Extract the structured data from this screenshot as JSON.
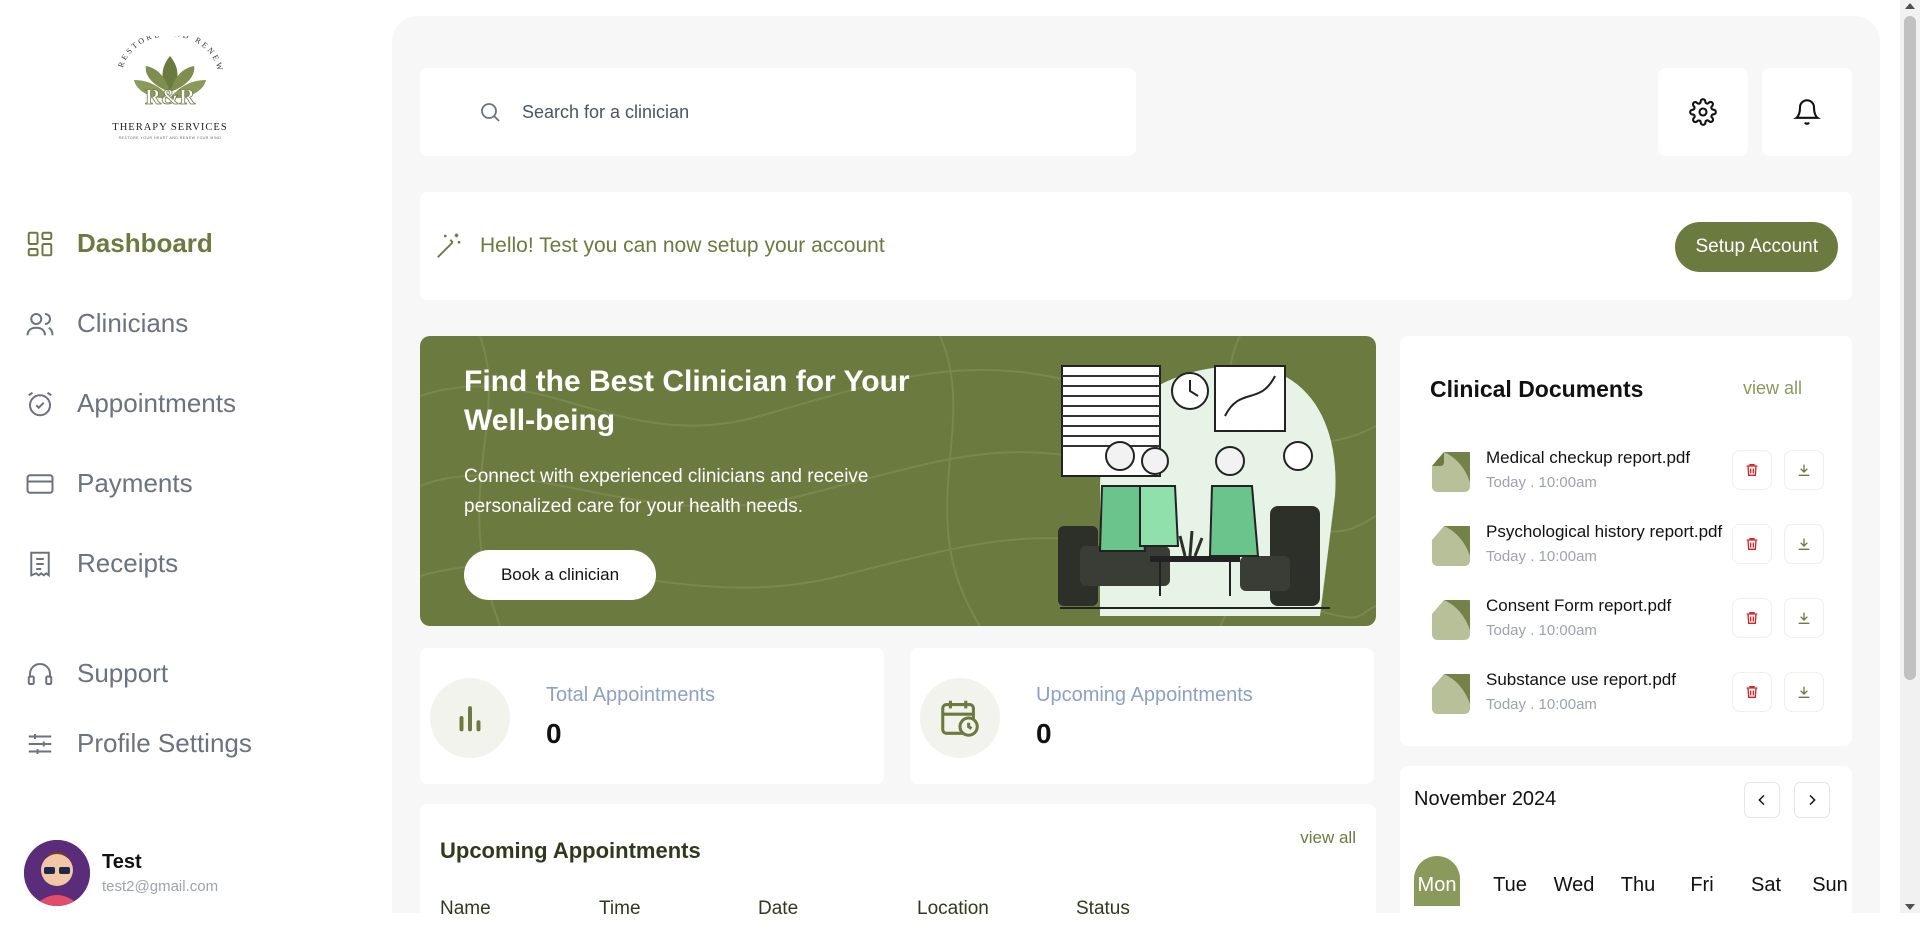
{
  "brand": {
    "arc_text": "RESTORE AND RENEW",
    "initials": "R&R",
    "name": "THERAPY SERVICES",
    "tagline": "RESTORE YOUR HEART AND RENEW YOUR MIND",
    "color": "#6b7b3f"
  },
  "sidebar": {
    "items": [
      {
        "label": "Dashboard",
        "icon": "dashboard-icon",
        "active": true
      },
      {
        "label": "Clinicians",
        "icon": "users-icon"
      },
      {
        "label": "Appointments",
        "icon": "alarm-clock-icon"
      },
      {
        "label": "Payments",
        "icon": "credit-card-icon"
      },
      {
        "label": "Receipts",
        "icon": "receipt-icon"
      },
      {
        "label": "Support",
        "icon": "headset-icon"
      },
      {
        "label": "Profile Settings",
        "icon": "sliders-icon"
      }
    ]
  },
  "user": {
    "name": "Test",
    "email": "test2@gmail.com"
  },
  "header": {
    "search_placeholder": "Search for a clinician"
  },
  "setup": {
    "message": "Hello! Test you can now setup your account",
    "button": "Setup Account"
  },
  "hero": {
    "title": "Find the Best Clinician for Your Well-being",
    "text": "Connect with experienced clinicians and receive personalized care for your health needs.",
    "button": "Book a clinician"
  },
  "stats": [
    {
      "label": "Total Appointments",
      "value": "0",
      "icon": "bar-chart-icon"
    },
    {
      "label": "Upcoming Appointments",
      "value": "0",
      "icon": "calendar-clock-icon"
    }
  ],
  "upcoming": {
    "title": "Upcoming Appointments",
    "view_all": "view all",
    "columns": [
      "Name",
      "Time",
      "Date",
      "Location",
      "Status"
    ]
  },
  "documents": {
    "title": "Clinical Documents",
    "view_all": "view all",
    "items": [
      {
        "name": "Medical checkup report.pdf",
        "time": "Today . 10:00am"
      },
      {
        "name": "Psychological history report.pdf",
        "time": "Today . 10:00am"
      },
      {
        "name": "Consent Form report.pdf",
        "time": "Today . 10:00am"
      },
      {
        "name": "Substance use report.pdf",
        "time": "Today . 10:00am"
      }
    ]
  },
  "calendar": {
    "month": "November 2024",
    "days": [
      "Mon",
      "Tue",
      "Wed",
      "Thu",
      "Fri",
      "Sat",
      "Sun"
    ],
    "selected": "Mon"
  }
}
